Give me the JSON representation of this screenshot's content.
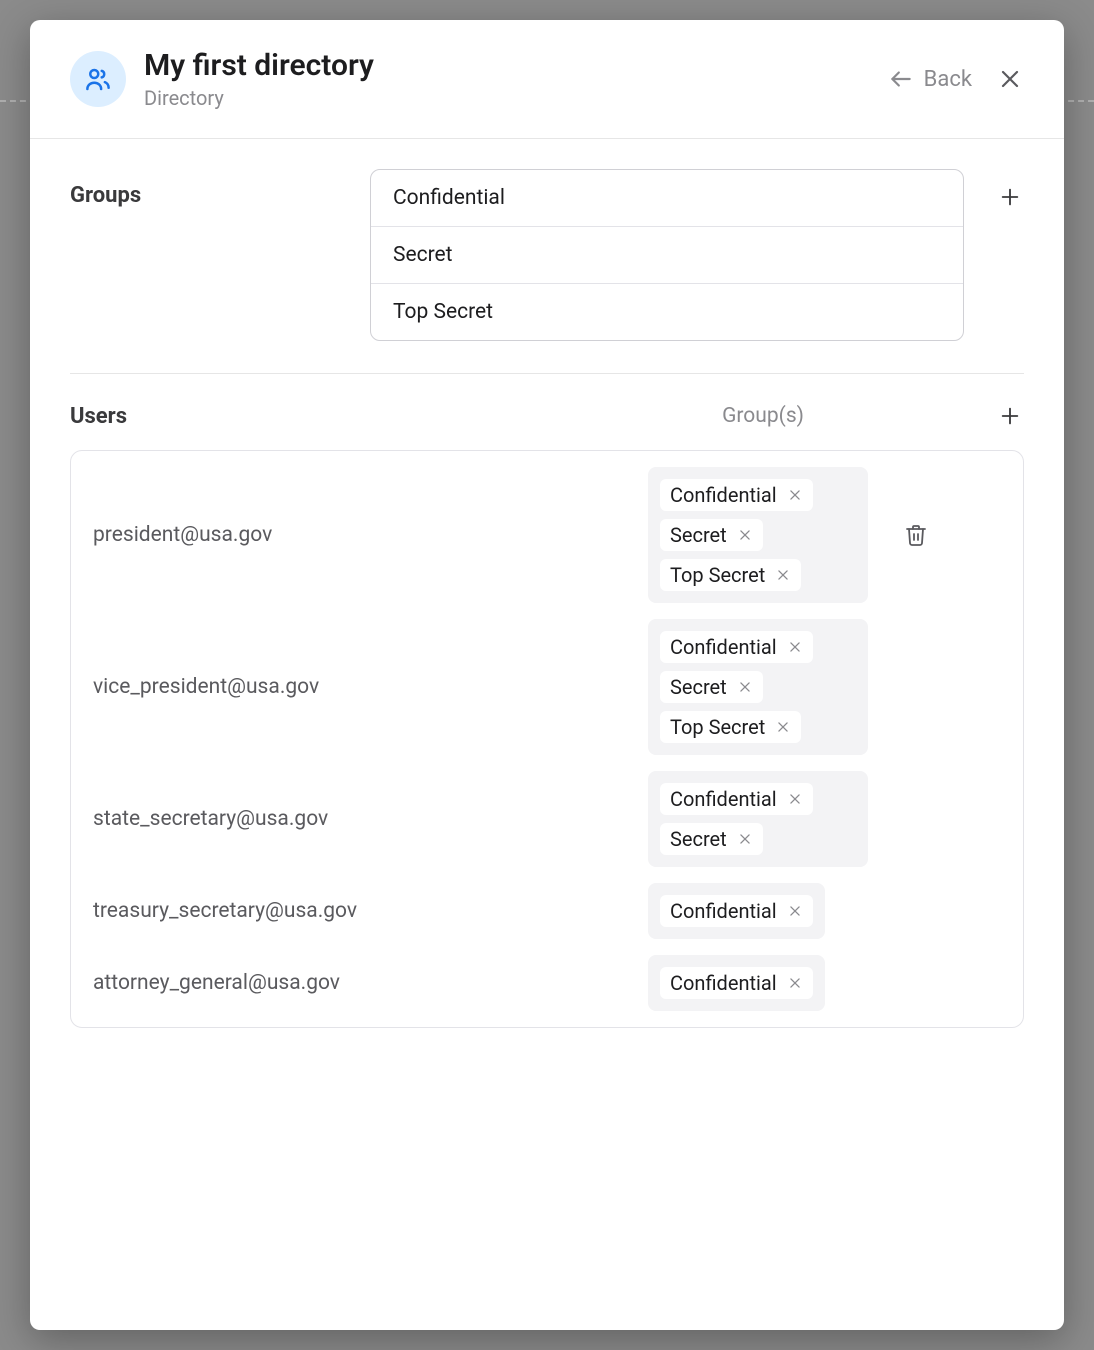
{
  "header": {
    "title": "My first directory",
    "subtitle": "Directory",
    "back_label": "Back"
  },
  "groups_section": {
    "label": "Groups",
    "items": [
      "Confidential",
      "Secret",
      "Top Secret"
    ]
  },
  "users_section": {
    "label": "Users",
    "groups_column_label": "Group(s)",
    "users": [
      {
        "email": "president@usa.gov",
        "groups": [
          "Confidential",
          "Secret",
          "Top Secret"
        ],
        "show_trash": true
      },
      {
        "email": "vice_president@usa.gov",
        "groups": [
          "Confidential",
          "Secret",
          "Top Secret"
        ],
        "show_trash": false
      },
      {
        "email": "state_secretary@usa.gov",
        "groups": [
          "Confidential",
          "Secret"
        ],
        "show_trash": false
      },
      {
        "email": "treasury_secretary@usa.gov",
        "groups": [
          "Confidential"
        ],
        "show_trash": false
      },
      {
        "email": "attorney_general@usa.gov",
        "groups": [
          "Confidential"
        ],
        "show_trash": false
      }
    ]
  }
}
